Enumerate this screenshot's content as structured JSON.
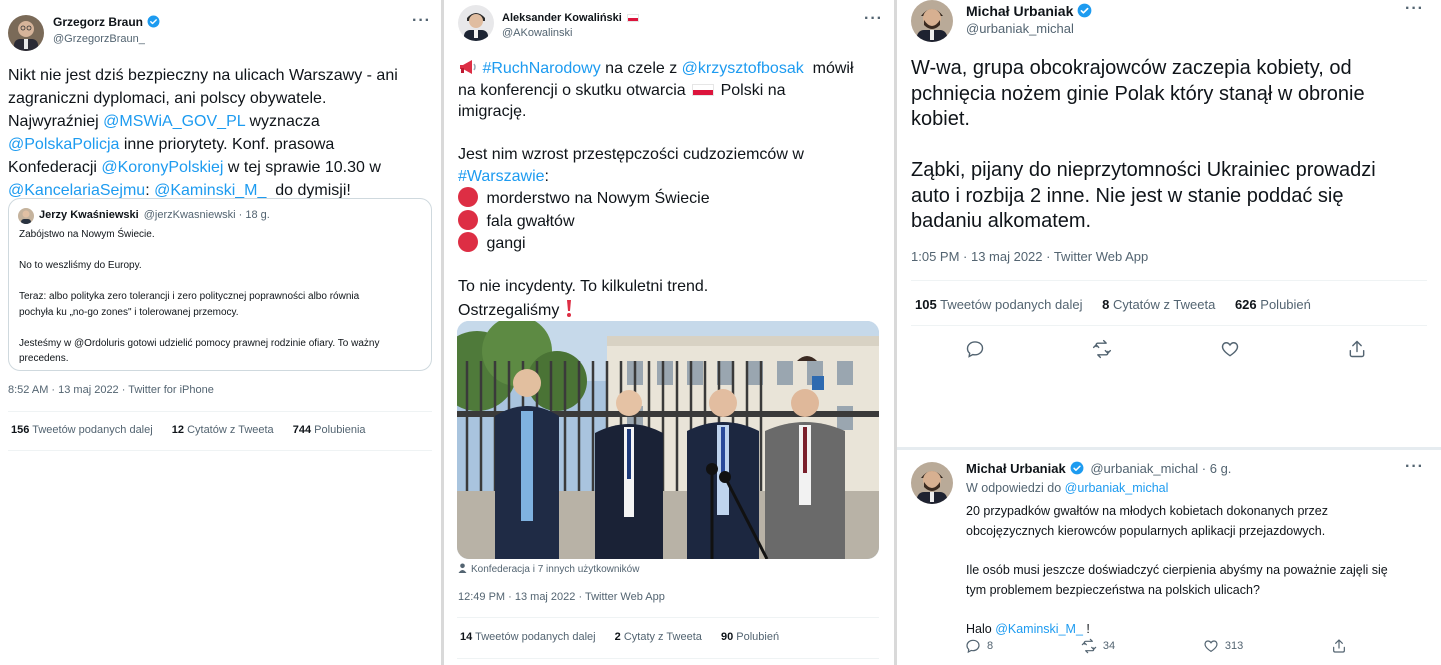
{
  "tweet1": {
    "name": "Grzegorz Braun",
    "handle": "@GrzegorzBraun_",
    "text_lines": [
      [
        {
          "t": "Nikt nie jest dziś bezpieczny na ulicach Warszawy - ani"
        }
      ],
      [
        {
          "t": "zagraniczni dyplomaci, ani polscy obywatele."
        }
      ],
      [
        {
          "t": "Najwyraźniej "
        },
        {
          "t": "@MSWiA_GOV_PL",
          "link": true
        },
        {
          "t": " wyznacza"
        }
      ],
      [
        {
          "t": "@PolskaPolicja",
          "link": true
        },
        {
          "t": " inne priorytety. Konf. prasowa"
        }
      ],
      [
        {
          "t": "Konfederacji "
        },
        {
          "t": "@KoronyPolskiej",
          "link": true
        },
        {
          "t": " w tej sprawie 10.30 w"
        }
      ],
      [
        {
          "t": "@KancelariaSejmu",
          "link": true
        },
        {
          "t": ": "
        },
        {
          "t": "@Kaminski_M_",
          "link": true
        },
        {
          "t": "  do dymisji!"
        }
      ]
    ],
    "quote": {
      "name": "Jerzy Kwaśniewski",
      "handle_time": "@jerzKwasniewski · 18 g.",
      "paragraphs": [
        [
          "Zabójstwo na Nowym Świecie."
        ],
        [
          "No to weszliśmy do Europy."
        ],
        [
          "Teraz: albo polityka zero tolerancji i zero politycznej poprawności albo równia",
          "pochyła ku „no-go zones\" i tolerowanej przemocy."
        ],
        [
          "Jesteśmy w @Ordoluris gotowi udzielić pomocy prawnej rodzinie ofiary. To ważny",
          "precedens."
        ]
      ]
    },
    "meta": "8:52 AM · 13 maj 2022 · Twitter for iPhone",
    "retweets": "156",
    "retweets_label": "Tweetów podanych dalej",
    "quotes": "12",
    "quotes_label": "Cytatów z Tweeta",
    "likes": "744",
    "likes_label": "Polubienia"
  },
  "tweet2": {
    "name": "Aleksander Kowaliński",
    "handle": "@AKowalinski",
    "text_lines": [
      [
        {
          "emoji": "megaphone"
        },
        {
          "t": " "
        },
        {
          "t": "#RuchNarodowy",
          "link": true
        },
        {
          "t": " na czele z "
        },
        {
          "t": "@krzysztofbosak",
          "link": true
        },
        {
          "t": "  mówił"
        }
      ],
      [
        {
          "t": "na konferencji o skutku otwarcia "
        },
        {
          "emoji": "flag"
        },
        {
          "t": " Polski na"
        }
      ],
      [
        {
          "t": "imigrację."
        }
      ],
      [
        {
          "t": ""
        }
      ],
      [
        {
          "t": "Jest nim wzrost przestępczości cudzoziemców w"
        }
      ],
      [
        {
          "t": "#Warszawie",
          "link": true
        },
        {
          "t": ":"
        }
      ],
      [
        {
          "emoji": "redcircle"
        },
        {
          "t": " morderstwo na Nowym Świecie"
        }
      ],
      [
        {
          "emoji": "redcircle"
        },
        {
          "t": " fala gwałtów"
        }
      ],
      [
        {
          "emoji": "redcircle"
        },
        {
          "t": " gangi"
        }
      ],
      [
        {
          "t": ""
        }
      ],
      [
        {
          "t": "To nie incydenty. To kilkuletni trend."
        }
      ],
      [
        {
          "t": "Ostrzegaliśmy "
        },
        {
          "emoji": "exclamation"
        }
      ]
    ],
    "photo_caption": "Konfederacja i 7 innych użytkowników",
    "meta": "12:49 PM · 13 maj 2022 · Twitter Web App",
    "retweets": "14",
    "retweets_label": "Tweetów podanych dalej",
    "quotes": "2",
    "quotes_label": "Cytaty z Tweeta",
    "likes": "90",
    "likes_label": "Polubień"
  },
  "tweet3": {
    "name": "Michał Urbaniak",
    "handle": "@urbaniak_michal",
    "text_lines": [
      "W-wa, grupa obcokrajowców zaczepia kobiety, od",
      "pchnięcia nożem ginie Polak który stanął w obronie",
      "kobiet.",
      "",
      "Ząbki, pijany do nieprzytomności Ukrainiec prowadzi",
      "auto i rozbija 2 inne. Nie jest w stanie poddać się",
      "badaniu alkomatem."
    ],
    "meta": "1:05 PM · 13 maj 2022 · Twitter Web App",
    "retweets": "105",
    "retweets_label": "Tweetów podanych dalej",
    "quotes": "8",
    "quotes_label": "Cytatów z Tweeta",
    "likes": "626",
    "likes_label": "Polubień"
  },
  "reply": {
    "name": "Michał Urbaniak",
    "handle_time": "@urbaniak_michal · 6 g.",
    "reply_to_prefix": "W odpowiedzi do ",
    "reply_to_handle": "@urbaniak_michal",
    "lines": [
      [
        {
          "t": "20 przypadków gwałtów na młodych kobietach dokonanych przez"
        }
      ],
      [
        {
          "t": "obcojęzycznych kierowców popularnych aplikacji przejazdowych."
        }
      ],
      [
        {
          "t": ""
        }
      ],
      [
        {
          "t": "Ile osób musi jeszcze doświadczyć cierpienia abyśmy na poważnie zajęli się"
        }
      ],
      [
        {
          "t": "tym problemem bezpieczeństwa na polskich ulicach?"
        }
      ],
      [
        {
          "t": ""
        }
      ],
      [
        {
          "t": "Halo "
        },
        {
          "t": "@Kaminski_M_",
          "link": true
        },
        {
          "t": " !"
        }
      ]
    ],
    "reply_count": "8",
    "retweet_count": "34",
    "like_count": "313"
  },
  "colors": {
    "link": "#1d9bf0",
    "muted": "#536471",
    "verified": "#1d9bf0",
    "emoji_red": "#dd2e44"
  }
}
